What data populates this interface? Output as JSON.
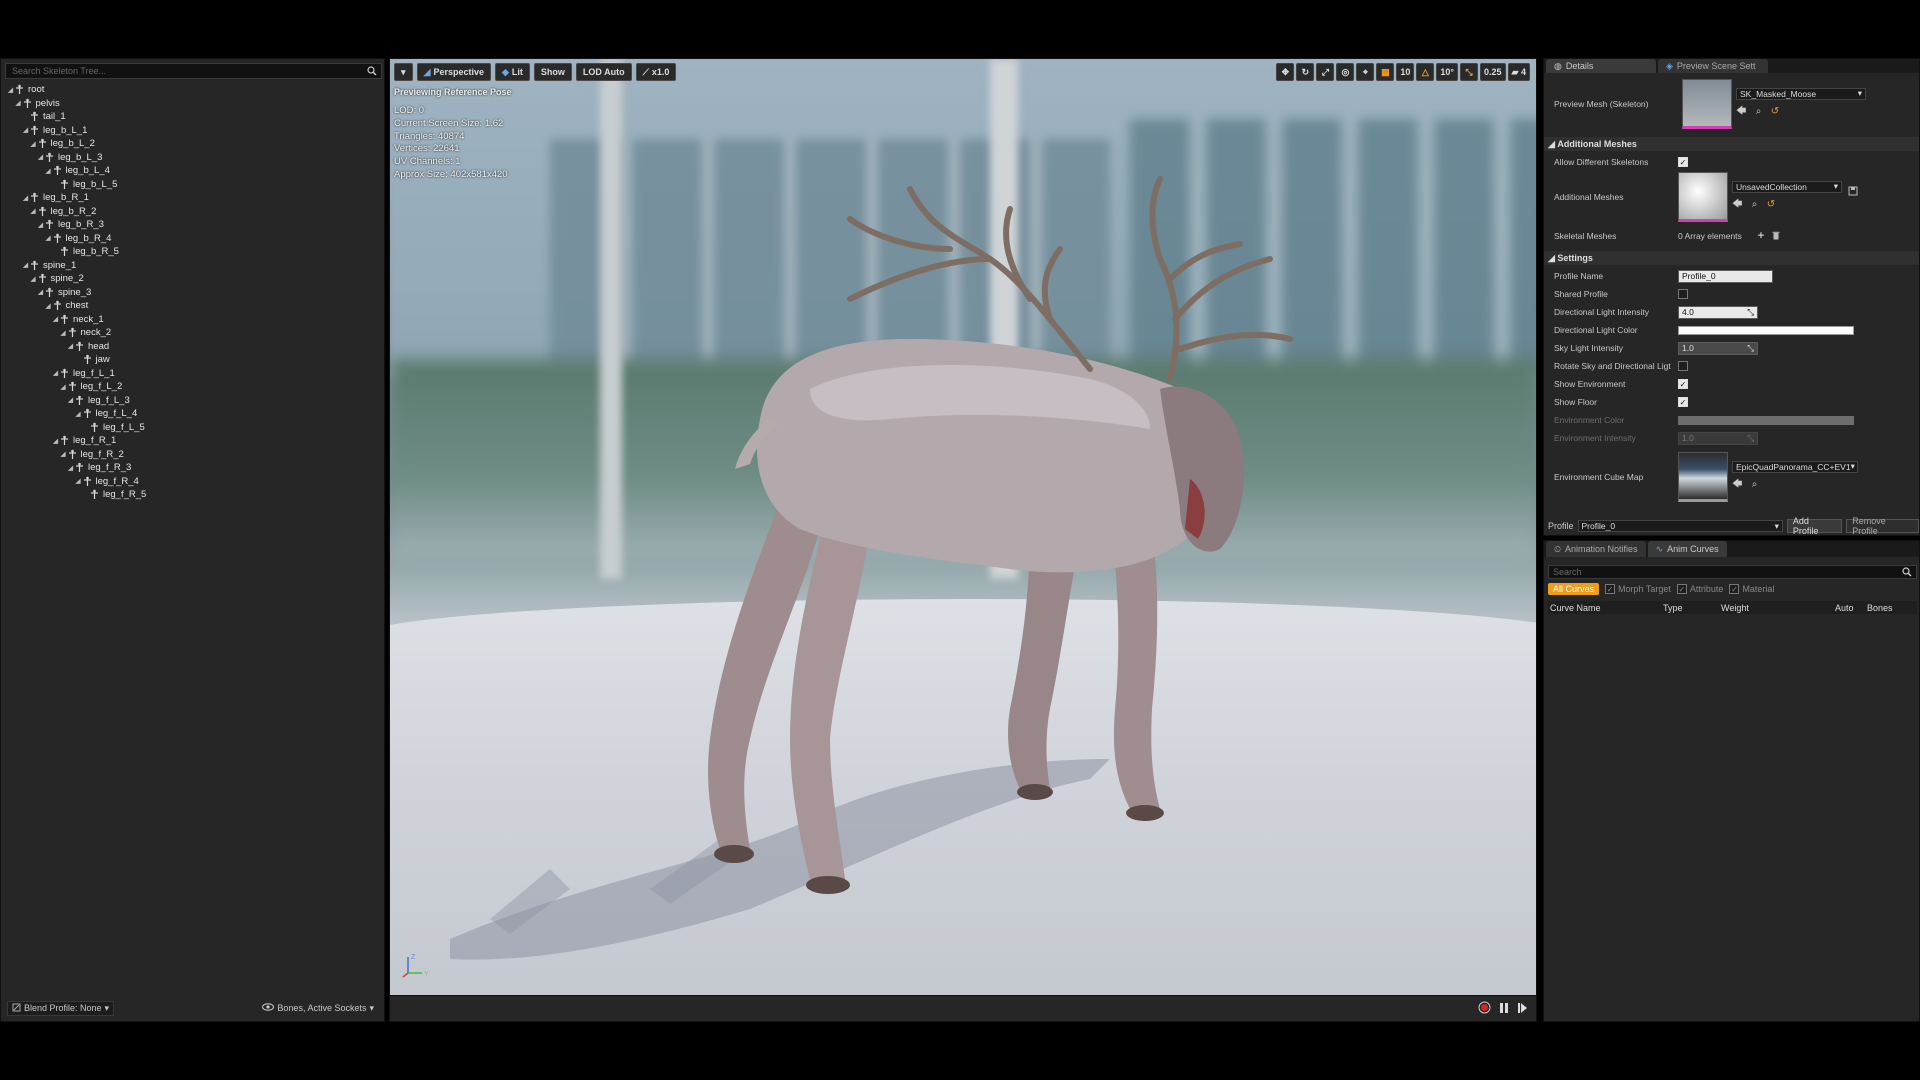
{
  "tree": {
    "search_placeholder": "Search Skeleton Tree...",
    "bones": [
      {
        "name": "root",
        "depth": 0,
        "expandable": true
      },
      {
        "name": "pelvis",
        "depth": 1,
        "expandable": true
      },
      {
        "name": "tail_1",
        "depth": 2,
        "expandable": false
      },
      {
        "name": "leg_b_L_1",
        "depth": 2,
        "expandable": true
      },
      {
        "name": "leg_b_L_2",
        "depth": 3,
        "expandable": true
      },
      {
        "name": "leg_b_L_3",
        "depth": 4,
        "expandable": true
      },
      {
        "name": "leg_b_L_4",
        "depth": 5,
        "expandable": true
      },
      {
        "name": "leg_b_L_5",
        "depth": 6,
        "expandable": false
      },
      {
        "name": "leg_b_R_1",
        "depth": 2,
        "expandable": true
      },
      {
        "name": "leg_b_R_2",
        "depth": 3,
        "expandable": true
      },
      {
        "name": "leg_b_R_3",
        "depth": 4,
        "expandable": true
      },
      {
        "name": "leg_b_R_4",
        "depth": 5,
        "expandable": true
      },
      {
        "name": "leg_b_R_5",
        "depth": 6,
        "expandable": false
      },
      {
        "name": "spine_1",
        "depth": 2,
        "expandable": true
      },
      {
        "name": "spine_2",
        "depth": 3,
        "expandable": true
      },
      {
        "name": "spine_3",
        "depth": 4,
        "expandable": true
      },
      {
        "name": "chest",
        "depth": 5,
        "expandable": true
      },
      {
        "name": "neck_1",
        "depth": 6,
        "expandable": true
      },
      {
        "name": "neck_2",
        "depth": 7,
        "expandable": true
      },
      {
        "name": "head",
        "depth": 8,
        "expandable": true
      },
      {
        "name": "jaw",
        "depth": 9,
        "expandable": false
      },
      {
        "name": "leg_f_L_1",
        "depth": 6,
        "expandable": true
      },
      {
        "name": "leg_f_L_2",
        "depth": 7,
        "expandable": true
      },
      {
        "name": "leg_f_L_3",
        "depth": 8,
        "expandable": true
      },
      {
        "name": "leg_f_L_4",
        "depth": 9,
        "expandable": true
      },
      {
        "name": "leg_f_L_5",
        "depth": 10,
        "expandable": false
      },
      {
        "name": "leg_f_R_1",
        "depth": 6,
        "expandable": true
      },
      {
        "name": "leg_f_R_2",
        "depth": 7,
        "expandable": true
      },
      {
        "name": "leg_f_R_3",
        "depth": 8,
        "expandable": true
      },
      {
        "name": "leg_f_R_4",
        "depth": 9,
        "expandable": true
      },
      {
        "name": "leg_f_R_5",
        "depth": 10,
        "expandable": false
      }
    ],
    "blend_profile_label": "Blend Profile: None",
    "bones_filter_label": "Bones, Active Sockets"
  },
  "viewport": {
    "perspective_label": "Perspective",
    "lit_label": "Lit",
    "show_label": "Show",
    "lod_label": "LOD Auto",
    "speed_label": "x1.0",
    "preview_label": "Previewing Reference Pose",
    "stats": [
      "LOD: 0",
      "Current Screen Size: 1.62",
      "Triangles: 40874",
      "Vertices: 22641",
      "UV Channels: 1",
      "Approx Size: 402x581x420"
    ],
    "grid_snap": "10",
    "rot_snap": "10°",
    "scale_snap": "0.25",
    "camera_speed": "4",
    "axis_z": "Z",
    "axis_y": "Y"
  },
  "details": {
    "tab_details": "Details",
    "tab_preview": "Preview Scene Sett",
    "preview_mesh_label": "Preview Mesh (Skeleton)",
    "preview_mesh_value": "SK_Masked_Moose",
    "additional_meshes_header": "Additional Meshes",
    "allow_diff_skeletons_label": "Allow Different Skeletons",
    "additional_meshes_label": "Additional Meshes",
    "additional_meshes_value": "UnsavedCollection",
    "skeletal_meshes_label": "Skeletal Meshes",
    "skeletal_meshes_value": "0 Array elements",
    "settings_header": "Settings",
    "profile_name_label": "Profile Name",
    "profile_name_value": "Profile_0",
    "shared_profile_label": "Shared Profile",
    "dir_light_intensity_label": "Directional Light Intensity",
    "dir_light_intensity_value": "4.0",
    "dir_light_color_label": "Directional Light Color",
    "sky_light_intensity_label": "Sky Light Intensity",
    "sky_light_intensity_value": "1.0",
    "rotate_sky_label": "Rotate Sky and Directional Ligt",
    "show_env_label": "Show Environment",
    "show_floor_label": "Show Floor",
    "env_color_label": "Environment Color",
    "env_intensity_label": "Environment Intensity",
    "env_intensity_value": "1.0",
    "env_cube_map_label": "Environment Cube Map",
    "env_cube_map_value": "EpicQuadPanorama_CC+EV1",
    "profile_label": "Profile",
    "profile_value": "Profile_0",
    "add_profile_label": "Add Profile",
    "remove_profile_label": "Remove Profile"
  },
  "curves": {
    "tab_notifies": "Animation Notifies",
    "tab_curves": "Anim Curves",
    "search_placeholder": "Search",
    "filter_all": "All Curves",
    "filter_morph": "Morph Target",
    "filter_attribute": "Attribute",
    "filter_material": "Material",
    "col_name": "Curve Name",
    "col_type": "Type",
    "col_weight": "Weight",
    "col_auto": "Auto",
    "col_bones": "Bones"
  },
  "colors": {
    "accent_orange": "#f09d18",
    "selection_blue": "#3d7ed8"
  }
}
